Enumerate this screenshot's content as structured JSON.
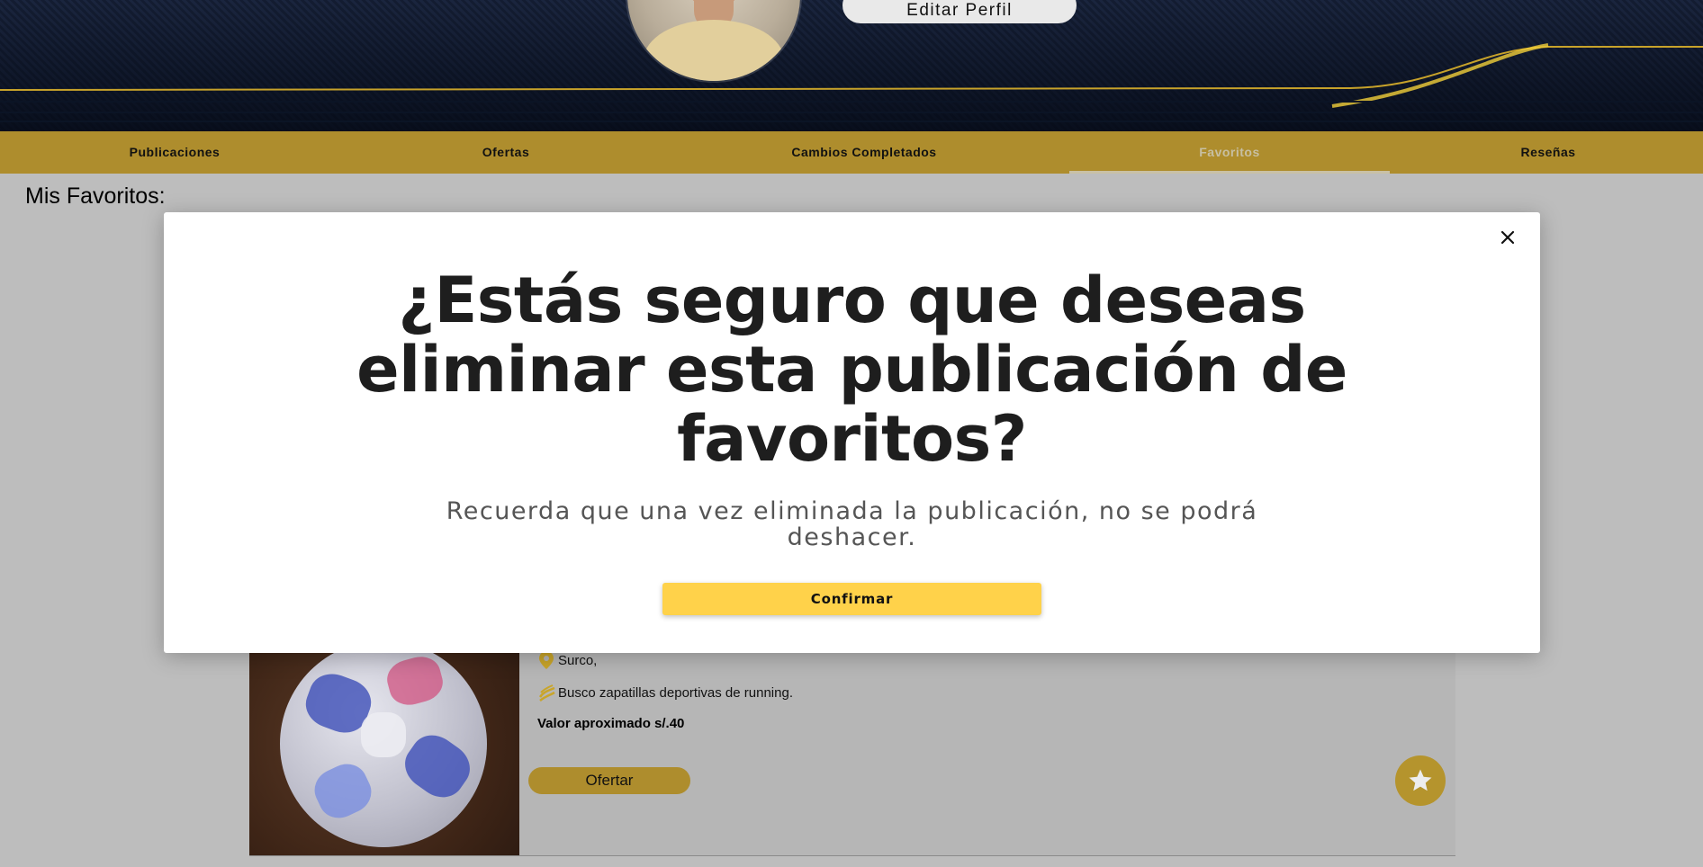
{
  "profile": {
    "edit_button_label": "Editar Perfil"
  },
  "tabs": [
    {
      "label": "Publicaciones"
    },
    {
      "label": "Ofertas"
    },
    {
      "label": "Cambios Completados"
    },
    {
      "label": "Favoritos",
      "active": true
    },
    {
      "label": "Reseñas"
    }
  ],
  "page": {
    "heading": "Mis Favoritos:"
  },
  "favorite_card": {
    "location": "Surco,",
    "seeking": "Busco zapatillas deportivas de running.",
    "value_label": "Valor aproximado s/.40",
    "offer_button_label": "Ofertar",
    "favorite_icon": "star-icon"
  },
  "modal": {
    "title": "¿Estás seguro que deseas eliminar esta publicación de favoritos?",
    "message": "Recuerda que una vez eliminada la publicación, no se podrá deshacer.",
    "confirm_label": "Confirmar",
    "close_icon": "close-icon"
  },
  "colors": {
    "tab_bar": "#ae8d2d",
    "confirm_button": "#ffd24a",
    "banner_dark": "#131c30",
    "accent_gold": "#d9b52c"
  }
}
